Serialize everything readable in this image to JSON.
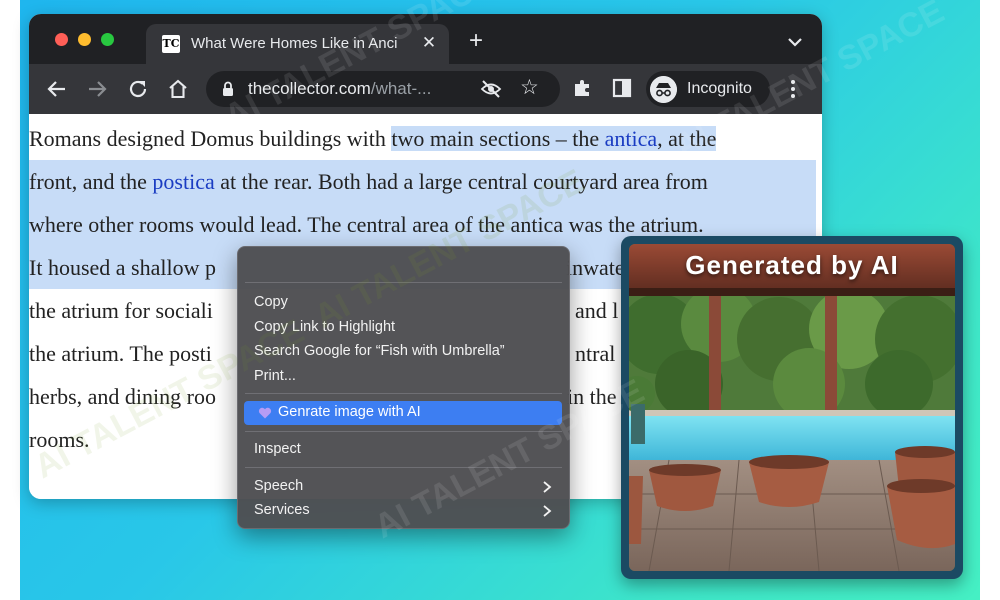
{
  "browser": {
    "tab_title": "What Were Homes Like in Anci",
    "favicon_text": "TC",
    "url_host": "thecollector.com",
    "url_path": "/what-...",
    "incognito_label": "Incognito"
  },
  "article": {
    "lines": [
      [
        "Romans designed Domus buildings with ",
        " two main sections – the ",
        "antica",
        ", at the"
      ],
      [
        "front, and the ",
        "postica",
        " at the rear. Both had a large central courtyard area from"
      ],
      [
        "where other rooms would lead. The central area of the antica was the atrium."
      ],
      [
        "It housed a shallow p",
        "inwate"
      ],
      [
        "the atrium for sociali",
        "and l"
      ],
      [
        "the atrium. The posti",
        "ntral a"
      ],
      [
        "herbs, and dining roo",
        "in the"
      ],
      [
        "rooms."
      ]
    ]
  },
  "context_menu": {
    "copy": "Copy",
    "copy_link": "Copy Link to Highlight",
    "search_google": "Search Google for “Fish with Umbrella”",
    "print": "Print...",
    "generate_ai": "Genrate image with AI",
    "inspect": "Inspect",
    "speech": "Speech",
    "services": "Services"
  },
  "ai_card": {
    "title": "Generated by AI"
  },
  "watermark": "AI TALENT SPACE",
  "colors": {
    "selection": "#c7dcf7",
    "link": "#1a3cc2",
    "menu_highlight": "#3d7ef2",
    "card_border": "#1b4a63"
  }
}
